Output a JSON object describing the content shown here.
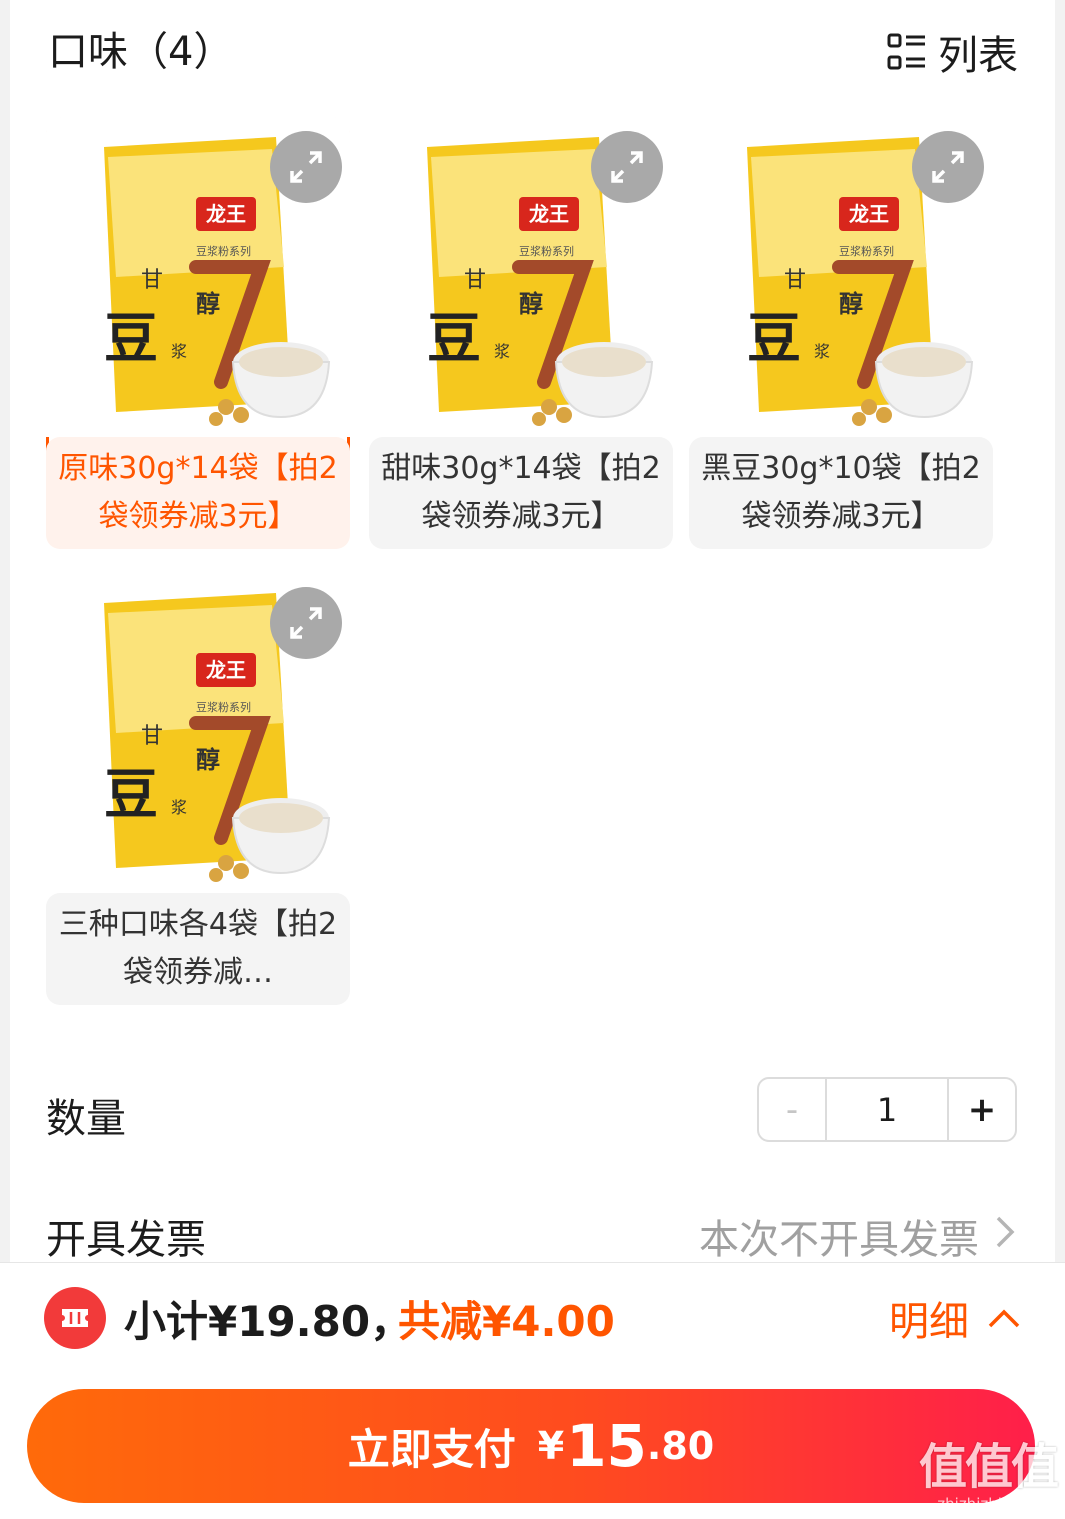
{
  "header": {
    "title": "口味（4）",
    "view_toggle_label": "列表"
  },
  "flavors": [
    {
      "label": "原味30g*14袋【拍2袋领券减3元】",
      "selected": true
    },
    {
      "label": "甜味30g*14袋【拍2袋领券减3元】",
      "selected": false
    },
    {
      "label": "黑豆30g*10袋【拍2袋领券减3元】",
      "selected": false
    },
    {
      "label": "三种口味各4袋【拍2袋领券减…",
      "selected": false
    }
  ],
  "product_image": {
    "brand": "龙王",
    "series": "豆浆粉系列",
    "line1": "甘",
    "line2": "醇",
    "big": "豆",
    "small": "浆"
  },
  "quantity": {
    "label": "数量",
    "minus": "-",
    "value": "1",
    "plus": "+"
  },
  "invoice": {
    "label": "开具发票",
    "value": "本次不开具发票"
  },
  "summary": {
    "subtotal": "小计¥19.80，",
    "discount": "共减¥4.00",
    "detail": "明细"
  },
  "pay": {
    "label": "立即支付",
    "currency": "¥",
    "integer": "15",
    "decimal": ".80"
  },
  "watermark": {
    "main": "值值值",
    "site": "zhizhizhi.com"
  },
  "colors": {
    "accent": "#ff5500",
    "coupon": "#f23a3a",
    "pay_start": "#ff6a0a",
    "pay_end": "#ff1f4a"
  }
}
